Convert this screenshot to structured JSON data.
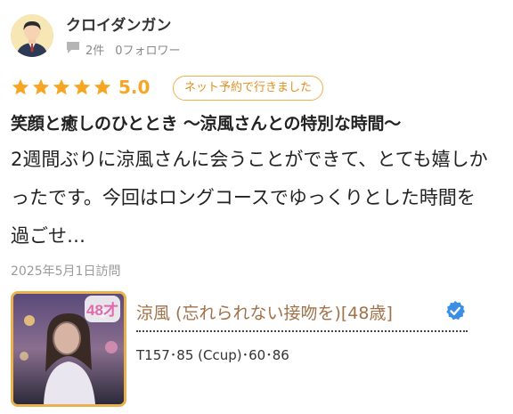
{
  "user": {
    "name": "クロイダンガン",
    "review_count": "2件",
    "followers": "0フォロワー",
    "avatar_icon": "user-avatar-icon"
  },
  "review": {
    "rating_stars": 5,
    "rating_value": "5.0",
    "badge": "ネット予約で行きました",
    "title": "笑顔と癒しのひととき 〜涼風さんとの特別な時間〜",
    "body": "2週間ぶりに涼風さんに会うことができて、とても嬉しかったです。今回はロングコースでゆっくりとした時間を過ごせ…",
    "visit_date": "2025年5月1日訪問"
  },
  "cast": {
    "name": "涼風 (忘れられない接吻を)[48歳]",
    "stats": "T157･85 (Ccup)･60･86",
    "photo_age_stamp": "48才",
    "verified_icon": "verified-check-icon"
  },
  "colors": {
    "accent_orange": "#f6a623",
    "badge_border": "#f0b04a",
    "cast_name": "#a0724a",
    "verified_blue": "#3a8ee6"
  }
}
